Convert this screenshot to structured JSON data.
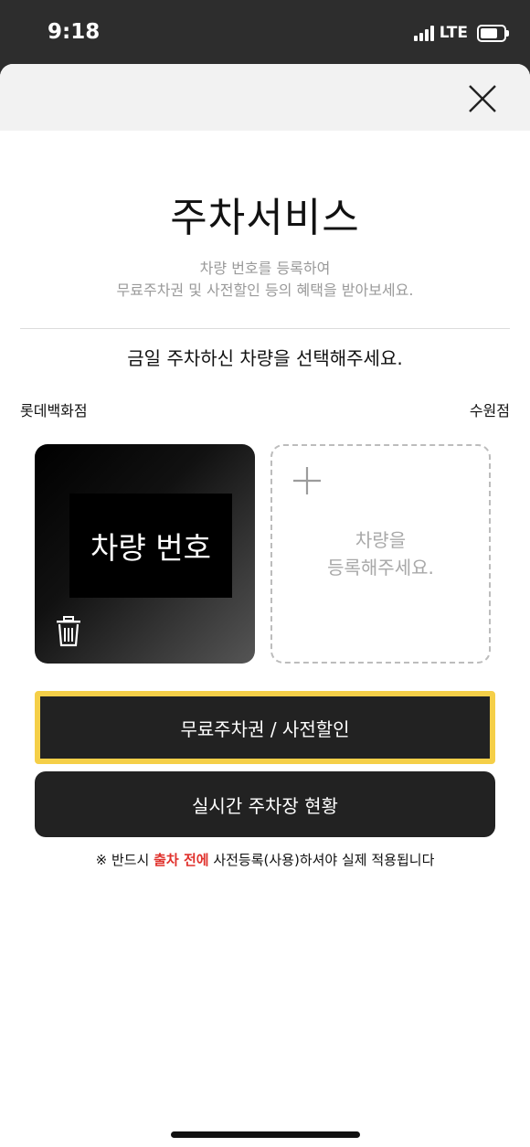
{
  "status_bar": {
    "time": "9:18",
    "network": "LTE"
  },
  "header": {
    "close_icon": "close-icon"
  },
  "main": {
    "title": "주차서비스",
    "subtitle_line1": "차량 번호를 등록하여",
    "subtitle_line2": "무료주차권 및 사전할인 등의 혜택을 받아보세요.",
    "prompt": "금일 주차하신 차량을 선택해주세요.",
    "store_name": "롯데백화점",
    "branch_name": "수원점"
  },
  "cars": {
    "registered": {
      "plate": "차량 번호",
      "delete_icon": "trash-icon"
    },
    "add": {
      "line1": "차량을",
      "line2": "등록해주세요.",
      "icon": "plus-icon"
    }
  },
  "buttons": {
    "free_parking": "무료주차권 / 사전할인",
    "live_status": "실시간 주차장 현황"
  },
  "notice": {
    "prefix": "※ 반드시 ",
    "highlight": "출차 전에",
    "suffix": " 사전등록(사용)하셔야 실제 적용됩니다"
  },
  "colors": {
    "accent": "#f5cf48",
    "highlight": "#e0312c",
    "button_bg": "#222222"
  }
}
